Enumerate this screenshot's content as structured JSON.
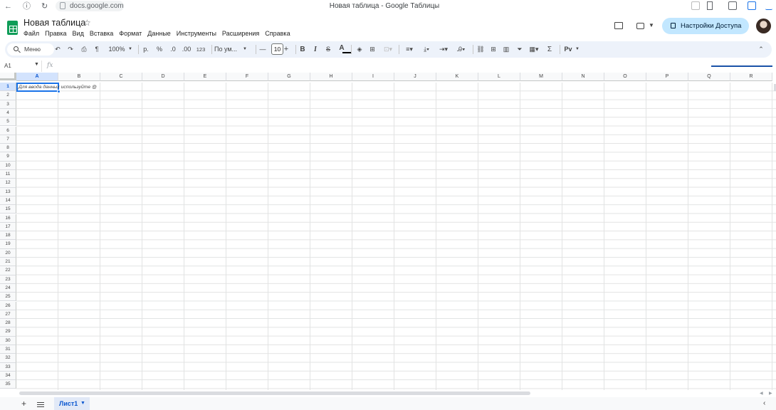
{
  "browser": {
    "back": "←",
    "info": "ⓘ",
    "reload": "↻",
    "url": "docs.google.com",
    "page_title": "Новая таблица - Google Таблицы"
  },
  "app": {
    "doc_title": "Новая таблица",
    "star": "☆",
    "menu": [
      "Файл",
      "Правка",
      "Вид",
      "Вставка",
      "Формат",
      "Данные",
      "Инструменты",
      "Расширения",
      "Справка"
    ],
    "share_label": "Настройки Доступа",
    "accent_color": "#c2e7ff"
  },
  "toolbar": {
    "search_label": "Меню",
    "undo": "↶",
    "redo": "↷",
    "zoom": "100%",
    "currency": "р.",
    "percent": "%",
    "decrease_decimal": ".0",
    "increase_decimal": ".00",
    "number_format": "123",
    "font": "По ум...",
    "font_size_minus": "—",
    "font_size": "10",
    "font_size_plus": "+",
    "bold": "B",
    "italic": "I",
    "strike": "S",
    "text_color": "A",
    "sigma": "Σ",
    "input_tools": "Pv",
    "collapse": "⌃"
  },
  "formula_bar": {
    "name_box": "A1",
    "fx": "fx"
  },
  "grid": {
    "columns": [
      "A",
      "B",
      "C",
      "D",
      "E",
      "F",
      "G",
      "H",
      "I",
      "J",
      "K",
      "L",
      "M",
      "N",
      "O",
      "P",
      "Q",
      "R"
    ],
    "rows": [
      "1",
      "2",
      "3",
      "4",
      "5",
      "6",
      "7",
      "8",
      "9",
      "10",
      "11",
      "12",
      "13",
      "14",
      "15",
      "16",
      "17",
      "18",
      "19",
      "20",
      "21",
      "22",
      "23",
      "24",
      "25",
      "26",
      "27",
      "28",
      "29",
      "30",
      "31",
      "32",
      "33",
      "34",
      "35"
    ],
    "selected_cell": "A1",
    "a1_hint": "Для ввода данных используйте @"
  },
  "sheets": {
    "add": "+",
    "tabs": [
      {
        "label": "Лист1"
      }
    ]
  }
}
